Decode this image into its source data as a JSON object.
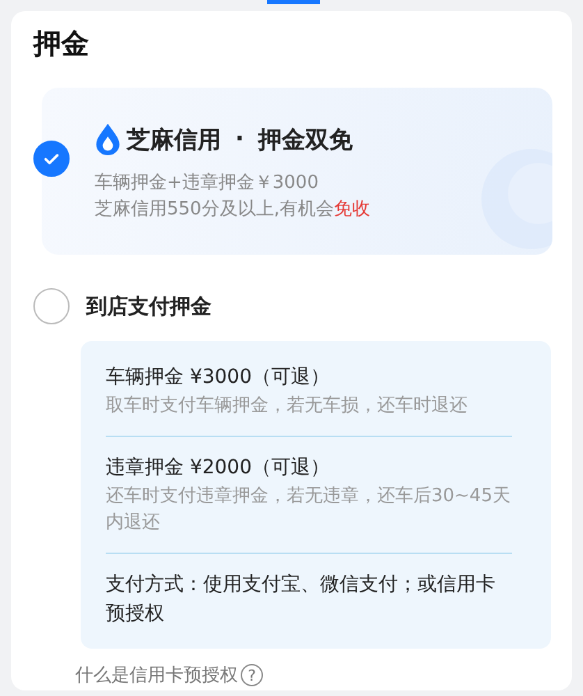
{
  "section_title": "押金",
  "options": [
    {
      "kind": "credit",
      "selected": true,
      "title_brand": "芝麻信用",
      "title_separator": "·",
      "title_main": "押金双免",
      "lines": [
        {
          "text": "车辆押金+违章押金￥3000"
        },
        {
          "text": "芝麻信用550分及以上,有机会",
          "highlight": "免收"
        }
      ]
    },
    {
      "kind": "store",
      "selected": false,
      "title_main": "到店支付押金",
      "details": [
        {
          "title": "车辆押金 ¥3000（可退）",
          "desc": "取车时支付车辆押金，若无车损，还车时退还"
        },
        {
          "title": "违章押金 ¥2000（可退）",
          "desc": "还车时支付违章押金，若无违章，还车后30~45天内退还"
        },
        {
          "title": "支付方式：使用支付宝、微信支付；或信用卡预授权"
        }
      ]
    }
  ],
  "help_link": {
    "text": "什么是信用卡预授权",
    "icon": "?"
  }
}
